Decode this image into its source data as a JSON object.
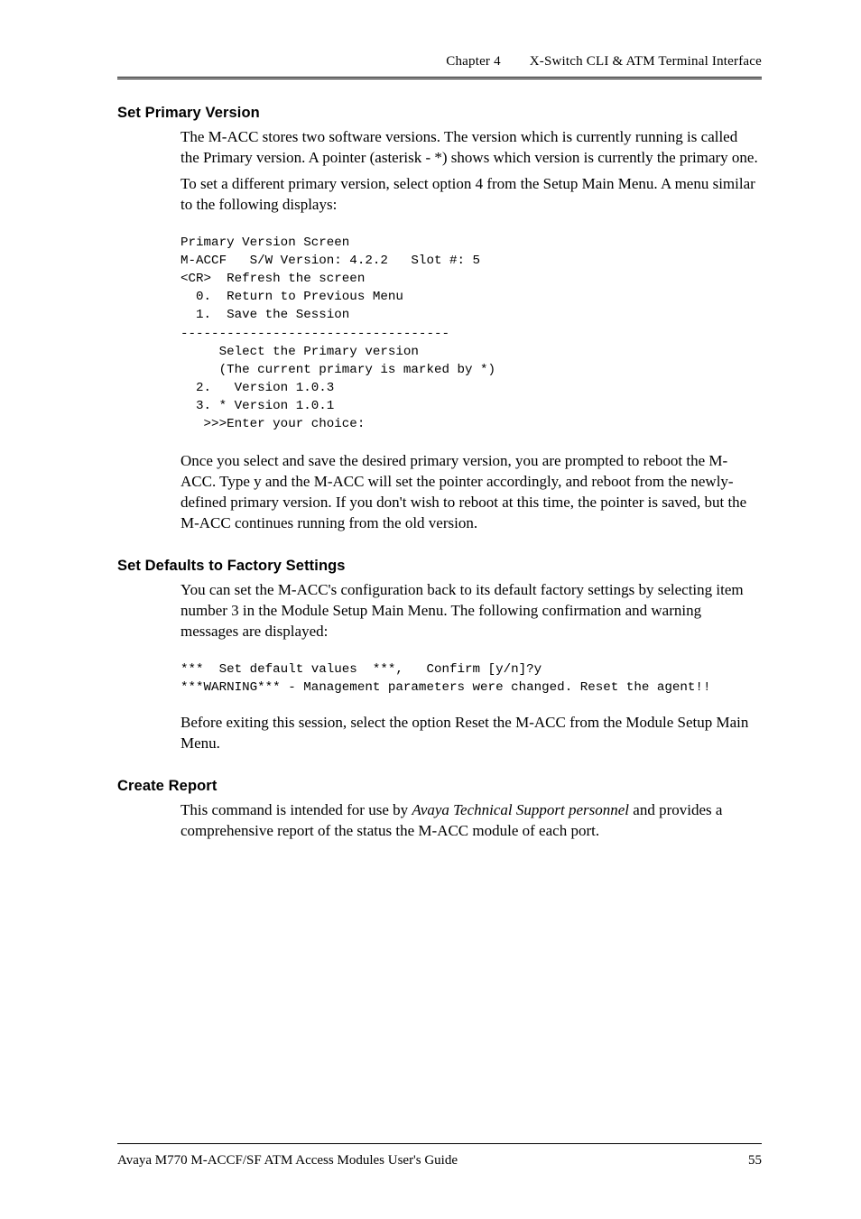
{
  "header": {
    "chapter_label": "Chapter 4",
    "chapter_title": "X-Switch CLI & ATM Terminal Interface"
  },
  "sections": {
    "set_primary_version": {
      "heading": "Set Primary Version",
      "para1": "The M-ACC stores two software versions. The version which is currently running is called the Primary version. A pointer (asterisk - *) shows which version is currently the primary one.",
      "para2": "To set a different primary version, select option 4 from the Setup Main Menu. A menu similar to the following displays:",
      "code": "Primary Version Screen\nM-ACCF   S/W Version: 4.2.2   Slot #: 5\n<CR>  Refresh the screen\n  0.  Return to Previous Menu\n  1.  Save the Session\n-----------------------------------\n     Select the Primary version\n     (The current primary is marked by *)\n  2.   Version 1.0.3\n  3. * Version 1.0.1\n   >>>Enter your choice:",
      "para3": "Once you select and save the desired primary version, you are prompted to reboot the M-ACC. Type y and the M-ACC will set the pointer accordingly, and reboot from the newly-defined primary version. If you don't wish to reboot at this time, the pointer is saved, but the M-ACC continues running from the old version."
    },
    "set_defaults": {
      "heading": "Set Defaults to Factory Settings",
      "para1": "You can set the M-ACC's configuration back to its default factory settings by selecting item number 3 in the Module Setup Main Menu. The following confirmation and warning messages are displayed:",
      "code": "***  Set default values  ***,   Confirm [y/n]?y\n***WARNING*** - Management parameters were changed. Reset the agent!!",
      "para2": "Before exiting this session, select the option Reset the M-ACC from the Module Setup Main Menu."
    },
    "create_report": {
      "heading": "Create Report",
      "para1_pre": "This command is intended for use by ",
      "para1_em": "Avaya Technical Support personnel",
      "para1_post": " and provides a comprehensive report of the status the M-ACC module of each port."
    }
  },
  "footer": {
    "guide_title": "Avaya M770 M-ACCF/SF ATM Access Modules User's Guide",
    "page_number": "55"
  }
}
